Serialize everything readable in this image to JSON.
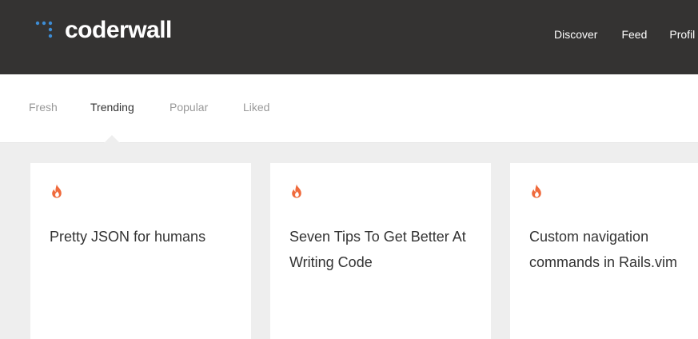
{
  "brand": {
    "name": "coderwall",
    "accent_color": "#3d8dd5"
  },
  "nav": {
    "items": [
      {
        "label": "Discover"
      },
      {
        "label": "Feed"
      },
      {
        "label": "Profil"
      }
    ]
  },
  "tabs": [
    {
      "label": "Fresh",
      "active": false
    },
    {
      "label": "Trending",
      "active": true
    },
    {
      "label": "Popular",
      "active": false
    },
    {
      "label": "Liked",
      "active": false
    }
  ],
  "cards": [
    {
      "icon": "flame-icon",
      "title": "Pretty JSON for humans"
    },
    {
      "icon": "flame-icon",
      "title": "Seven Tips To Get Better At Writing Code"
    },
    {
      "icon": "flame-icon",
      "title": "Custom navigation commands in Rails.vim"
    }
  ],
  "colors": {
    "header_bg": "#343332",
    "flame": "#ef6a3c",
    "page_bg": "#eeeeee"
  }
}
